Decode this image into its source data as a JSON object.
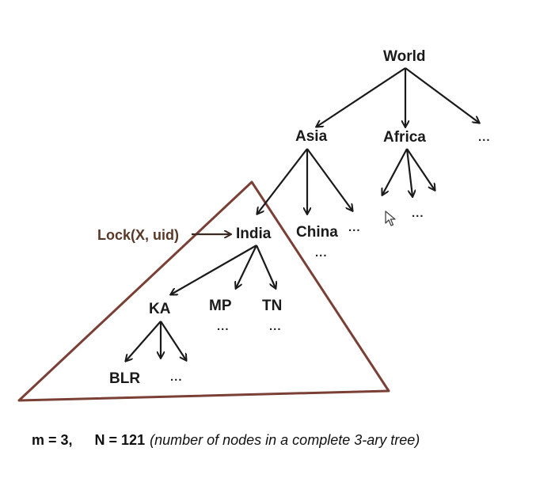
{
  "nodes": {
    "world": "World",
    "asia": "Asia",
    "africa": "Africa",
    "india": "India",
    "china": "China",
    "ka": "KA",
    "mp": "MP",
    "tn": "TN",
    "blr": "BLR"
  },
  "ellipsis": "...",
  "lock_label": "Lock(X, uid)",
  "caption": {
    "m": "m = 3,",
    "n": "N = 121",
    "note": "(number of nodes in a complete 3-ary tree)"
  },
  "colors": {
    "triangle": "#7a3f35",
    "edges": "#1a1a1a"
  }
}
